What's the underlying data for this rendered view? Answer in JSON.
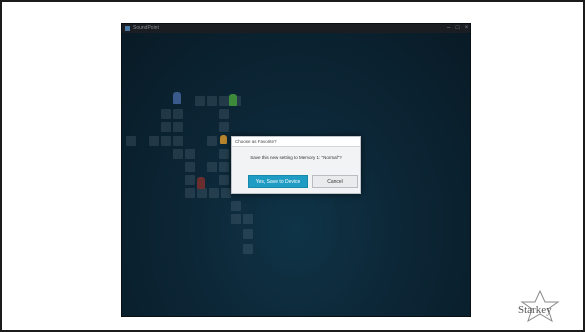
{
  "window": {
    "title": "SoundPoint",
    "controls": {
      "minimize": "–",
      "maximize": "□",
      "close": "×"
    }
  },
  "dialog": {
    "title": "Choose as Favorite?",
    "message": "Save this new setting to Memory 1: \"Normal\"?",
    "yes_label": "Yes, Save to Device",
    "cancel_label": "Cancel",
    "accent_color": "#1f9cc4"
  },
  "brand": {
    "logo_text": "Starkey"
  },
  "icons": [
    "app-icon",
    "minimize-icon",
    "maximize-icon",
    "close-icon",
    "starkey-star-logo"
  ]
}
